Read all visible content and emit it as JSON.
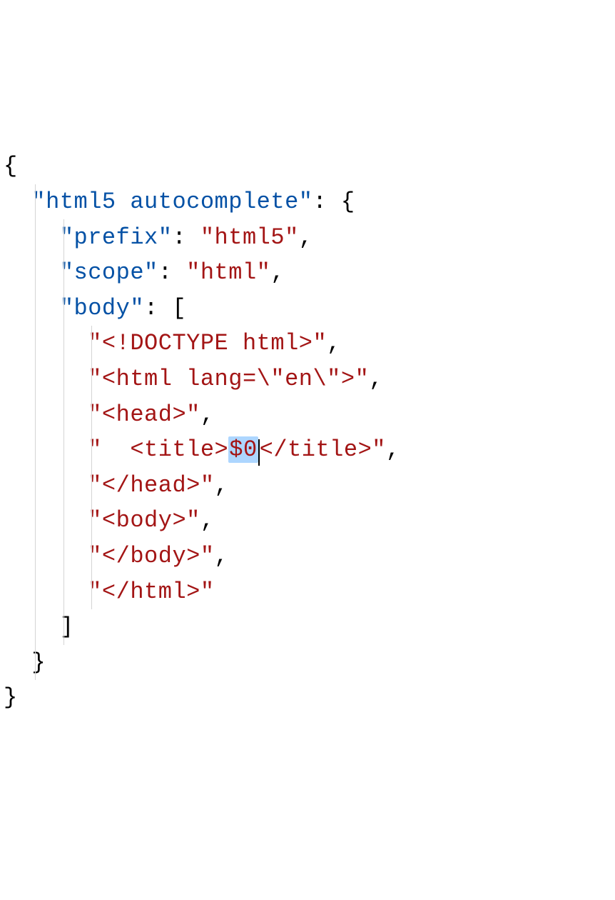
{
  "colors": {
    "key": "#0451a5",
    "string": "#a31515",
    "punctuation": "#000000",
    "selection": "#add6ff",
    "guide": "#d4d4d4",
    "bg": "#ffffff"
  },
  "selection": {
    "text": "$0",
    "cursor_after": true,
    "line_index": 8
  },
  "indent_unit": "  ",
  "lines": [
    {
      "indent": 0,
      "parts": [
        {
          "t": "punct",
          "v": "{"
        }
      ]
    },
    {
      "indent": 1,
      "parts": [
        {
          "t": "key",
          "v": "\"html5 autocomplete\""
        },
        {
          "t": "punct",
          "v": ": {"
        }
      ]
    },
    {
      "indent": 2,
      "parts": [
        {
          "t": "key",
          "v": "\"prefix\""
        },
        {
          "t": "punct",
          "v": ": "
        },
        {
          "t": "str",
          "v": "\"html5\""
        },
        {
          "t": "punct",
          "v": ","
        }
      ]
    },
    {
      "indent": 2,
      "parts": [
        {
          "t": "key",
          "v": "\"scope\""
        },
        {
          "t": "punct",
          "v": ": "
        },
        {
          "t": "str",
          "v": "\"html\""
        },
        {
          "t": "punct",
          "v": ","
        }
      ]
    },
    {
      "indent": 2,
      "parts": [
        {
          "t": "key",
          "v": "\"body\""
        },
        {
          "t": "punct",
          "v": ": ["
        }
      ]
    },
    {
      "indent": 3,
      "parts": [
        {
          "t": "str",
          "v": "\"<!DOCTYPE html>\""
        },
        {
          "t": "punct",
          "v": ","
        }
      ]
    },
    {
      "indent": 3,
      "parts": [
        {
          "t": "str",
          "v": "\"<html lang=\\\"en\\\">\""
        },
        {
          "t": "punct",
          "v": ","
        }
      ]
    },
    {
      "indent": 3,
      "parts": [
        {
          "t": "str",
          "v": "\"<head>\""
        },
        {
          "t": "punct",
          "v": ","
        }
      ]
    },
    {
      "indent": 3,
      "parts": [
        {
          "t": "str",
          "v-before-sel": "\"  <title>",
          "sel": "$0",
          "v-after-sel": "</title>\""
        },
        {
          "t": "punct",
          "v": ","
        }
      ]
    },
    {
      "indent": 3,
      "parts": [
        {
          "t": "str",
          "v": "\"</head>\""
        },
        {
          "t": "punct",
          "v": ","
        }
      ]
    },
    {
      "indent": 3,
      "parts": [
        {
          "t": "str",
          "v": "\"<body>\""
        },
        {
          "t": "punct",
          "v": ","
        }
      ]
    },
    {
      "indent": 3,
      "parts": [
        {
          "t": "str",
          "v": "\"</body>\""
        },
        {
          "t": "punct",
          "v": ","
        }
      ]
    },
    {
      "indent": 3,
      "parts": [
        {
          "t": "str",
          "v": "\"</html>\""
        }
      ]
    },
    {
      "indent": 2,
      "parts": [
        {
          "t": "punct",
          "v": "]"
        }
      ]
    },
    {
      "indent": 1,
      "parts": [
        {
          "t": "punct",
          "v": "}"
        }
      ]
    },
    {
      "indent": 0,
      "parts": [
        {
          "t": "punct",
          "v": "}"
        }
      ]
    }
  ]
}
